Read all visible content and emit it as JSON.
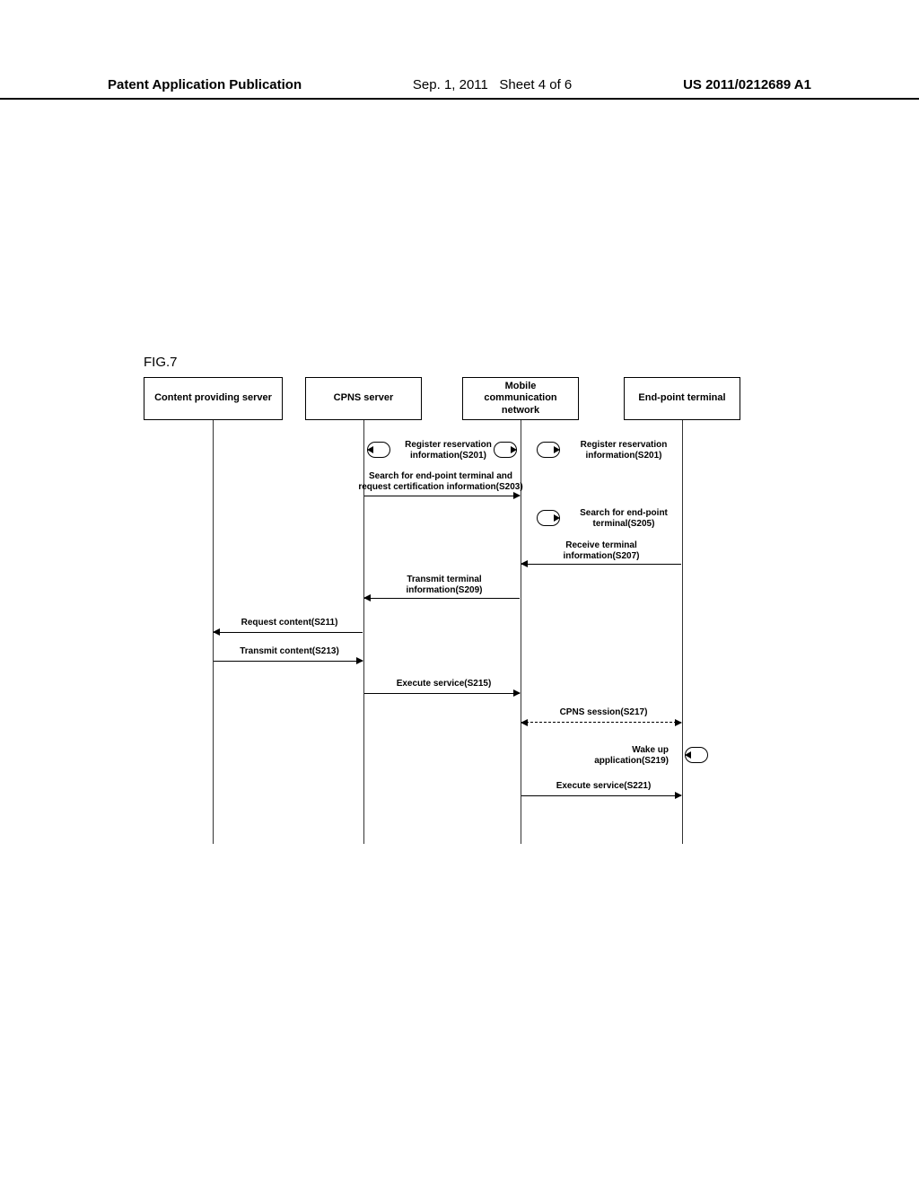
{
  "header": {
    "left": "Patent Application Publication",
    "center": "Sep. 1, 2011   Sheet 4 of 6",
    "right": "US 2011/0212689 A1"
  },
  "figure_label": "FIG.7",
  "participants": {
    "content_server": "Content providing server",
    "cpns_server": "CPNS server",
    "mobile_net": "Mobile\ncommunication\nnetwork",
    "endpoint": "End-point terminal"
  },
  "messages": {
    "s201a": "Register reservation\ninformation(S201)",
    "s201b": "Register reservation\ninformation(S201)",
    "s203": "Search for end-point terminal and\nrequest certification information(S203)",
    "s205": "Search for end-point\nterminal(S205)",
    "s207": "Receive terminal\ninformation(S207)",
    "s209": "Transmit terminal\ninformation(S209)",
    "s211": "Request content(S211)",
    "s213": "Transmit content(S213)",
    "s215": "Execute service(S215)",
    "s217": "CPNS session(S217)",
    "s219": "Wake up\napplication(S219)",
    "s221": "Execute service(S221)"
  }
}
